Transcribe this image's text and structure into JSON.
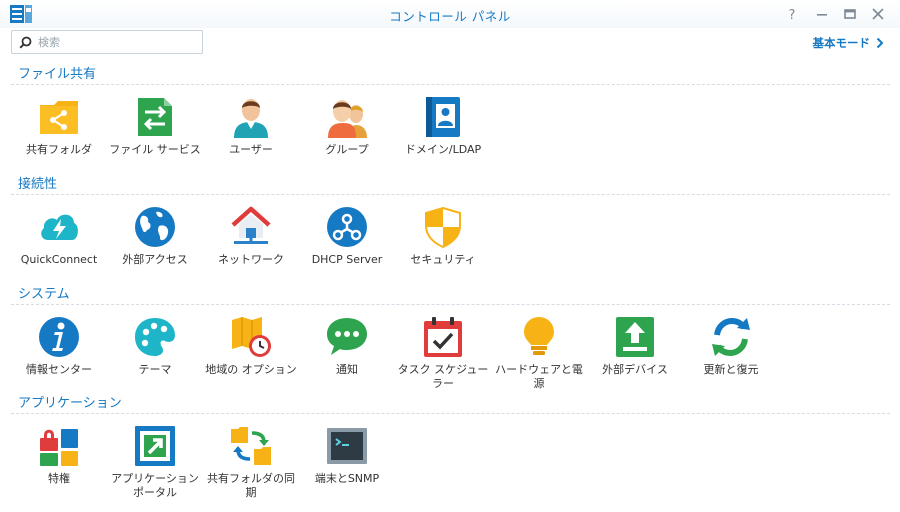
{
  "window": {
    "title": "コントロール パネル",
    "help_label": "?",
    "mode_link": "基本モード"
  },
  "search": {
    "placeholder": "検索",
    "value": ""
  },
  "colors": {
    "accent": "#1679c3",
    "divider": "#d5dde4"
  },
  "sections": [
    {
      "title": "ファイル共有",
      "items": [
        {
          "label": "共有フォルダ",
          "icon": "shared-folder-icon"
        },
        {
          "label": "ファイル サービス",
          "icon": "file-services-icon"
        },
        {
          "label": "ユーザー",
          "icon": "user-icon"
        },
        {
          "label": "グループ",
          "icon": "group-icon"
        },
        {
          "label": "ドメイン/LDAP",
          "icon": "domain-ldap-icon"
        }
      ]
    },
    {
      "title": "接続性",
      "items": [
        {
          "label": "QuickConnect",
          "icon": "quickconnect-icon"
        },
        {
          "label": "外部アクセス",
          "icon": "globe-icon"
        },
        {
          "label": "ネットワーク",
          "icon": "network-house-icon"
        },
        {
          "label": "DHCP Server",
          "icon": "dhcp-icon"
        },
        {
          "label": "セキュリティ",
          "icon": "shield-icon"
        }
      ]
    },
    {
      "title": "システム",
      "items": [
        {
          "label": "情報センター",
          "icon": "info-icon"
        },
        {
          "label": "テーマ",
          "icon": "palette-icon"
        },
        {
          "label": "地域の オプション",
          "icon": "map-clock-icon"
        },
        {
          "label": "通知",
          "icon": "chat-bubble-icon"
        },
        {
          "label": "タスク スケジューラー",
          "icon": "calendar-check-icon"
        },
        {
          "label": "ハードウェアと電源",
          "icon": "lightbulb-icon"
        },
        {
          "label": "外部デバイス",
          "icon": "upload-device-icon"
        },
        {
          "label": "更新と復元",
          "icon": "refresh-icon"
        }
      ]
    },
    {
      "title": "アプリケーション",
      "items": [
        {
          "label": "特権",
          "icon": "privileges-icon"
        },
        {
          "label": "アプリケーション ポータル",
          "icon": "app-portal-icon"
        },
        {
          "label": "共有フォルダの同期",
          "icon": "folder-sync-icon"
        },
        {
          "label": "端末とSNMP",
          "icon": "terminal-icon"
        }
      ]
    }
  ]
}
